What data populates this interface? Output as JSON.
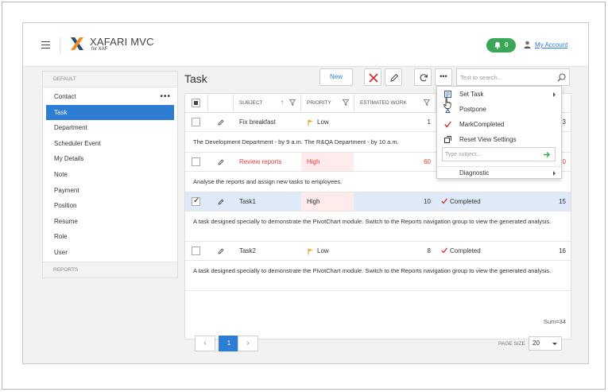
{
  "header": {
    "brand": "XAFARI MVC",
    "brand_sub": "for XAF",
    "notifications_count": "0",
    "account_label": "My Account",
    "colors": {
      "brand_green": "#3aa757",
      "accent_blue": "#2d7dd2",
      "logo_orange": "#f08a24",
      "logo_dark": "#1f4e79"
    }
  },
  "nav": {
    "group_default": "DEFAULT",
    "group_reports": "REPORTS",
    "items": [
      {
        "label": "Contact",
        "has_more": true,
        "more_label": "•••"
      },
      {
        "label": "Task",
        "active": true
      },
      {
        "label": "Department"
      },
      {
        "label": "Scheduler Event"
      },
      {
        "label": "My Details"
      },
      {
        "label": "Note"
      },
      {
        "label": "Payment"
      },
      {
        "label": "Position"
      },
      {
        "label": "Resume"
      },
      {
        "label": "Role"
      },
      {
        "label": "User"
      }
    ]
  },
  "page": {
    "title": "Task"
  },
  "toolbar": {
    "new_label": "New",
    "more_label": "•••",
    "search_placeholder": "Text to search...",
    "icons": [
      "delete-icon",
      "edit-icon",
      "refresh-icon",
      "more-icon",
      "search-icon"
    ]
  },
  "grid": {
    "columns": [
      "SUBJECT",
      "PRIORITY",
      "ESTIMATED WORK"
    ],
    "rows": [
      {
        "subject": "Fix breakfast",
        "priority": "Low",
        "estimated_work": "1",
        "status": "",
        "extra": "3",
        "preview": "The Development Department - by 9 a.m. The R&QA Department - by 10 a.m.",
        "checked": false,
        "overdue": false
      },
      {
        "subject": "Review reports",
        "priority": "High",
        "estimated_work": "60",
        "status": "",
        "extra": "0",
        "preview": "Analyse the reports and assign new tasks to employees.",
        "checked": false,
        "overdue": true
      },
      {
        "subject": "Task1",
        "priority": "High",
        "estimated_work": "10",
        "status": "Completed",
        "extra": "15",
        "preview": "A task designed specially to demonstrate the PivotChart module. Switch to the Reports navigation group to view the generated analysis.",
        "checked": true,
        "overdue": false
      },
      {
        "subject": "Task2",
        "priority": "Low",
        "estimated_work": "8",
        "status": "Completed",
        "extra": "16",
        "preview": "A task designed specially to demonstrate the PivotChart module. Switch to the Reports navigation group to view the generated analysis.",
        "checked": false,
        "overdue": false
      }
    ],
    "sum_label": "Sum=34"
  },
  "pager": {
    "prev": "‹",
    "current_page": "1",
    "next": "›",
    "page_size_label": "PAGE SIZE",
    "page_size_value": "20"
  },
  "context_menu": {
    "items": [
      {
        "label": "Set Task",
        "icon": "set-task-icon",
        "submenu": true
      },
      {
        "label": "Postpone",
        "icon": "hourglass-icon",
        "submenu": false
      },
      {
        "label": "MarkCompleted",
        "icon": "checkmark-icon",
        "submenu": false
      },
      {
        "label": "Reset View Settings",
        "icon": "reset-view-icon",
        "submenu": false
      },
      {
        "label": "Diagnostic",
        "icon": "",
        "submenu": true
      }
    ],
    "subject_placeholder": "Type subject..."
  }
}
